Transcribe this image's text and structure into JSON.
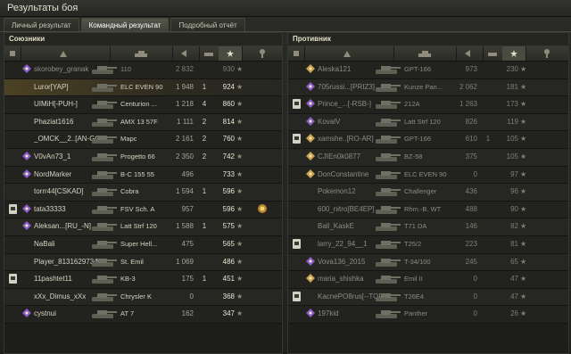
{
  "window": {
    "title": "Результаты боя"
  },
  "tabs": [
    {
      "label": "Личный результат",
      "active": false
    },
    {
      "label": "Командный результат",
      "active": true
    },
    {
      "label": "Подробный отчёт",
      "active": false
    }
  ],
  "allies": {
    "title": "Союзники",
    "rows": [
      {
        "name": "skorobey_granak",
        "tank": "110",
        "damage": "2 832",
        "frags": "",
        "xp": "930",
        "alive": false,
        "ribbon": false,
        "badge": "purple",
        "me": false
      },
      {
        "name": "Luror[YAP]",
        "tank": "ELC EVEN 90",
        "damage": "1 948",
        "frags": "1",
        "xp": "924",
        "alive": true,
        "ribbon": false,
        "badge": "",
        "me": true
      },
      {
        "name": "UIMiH[-PUH-]",
        "tank": "Centurion ...",
        "damage": "1 218",
        "frags": "4",
        "xp": "860",
        "alive": true,
        "ribbon": false,
        "badge": "",
        "me": false
      },
      {
        "name": "Phaziat1616",
        "tank": "AMX 13 57F",
        "damage": "1 111",
        "frags": "2",
        "xp": "814",
        "alive": true,
        "ribbon": false,
        "badge": "",
        "me": false
      },
      {
        "name": "_OMCK__2..[AN-GO]",
        "tank": "Марс",
        "damage": "2 161",
        "frags": "2",
        "xp": "760",
        "alive": true,
        "ribbon": false,
        "badge": "",
        "me": false
      },
      {
        "name": "V0vAn73_1",
        "tank": "Progetto 66",
        "damage": "2 350",
        "frags": "2",
        "xp": "742",
        "alive": true,
        "ribbon": false,
        "badge": "purple",
        "me": false
      },
      {
        "name": "NordMarker",
        "tank": "В-С 155 55",
        "damage": "496",
        "frags": "",
        "xp": "733",
        "alive": true,
        "ribbon": false,
        "badge": "purple",
        "me": false
      },
      {
        "name": "torrr44[CSKAD]",
        "tank": "Cobra",
        "damage": "1 594",
        "frags": "1",
        "xp": "596",
        "alive": true,
        "ribbon": false,
        "badge": "",
        "me": false
      },
      {
        "name": "tata33333",
        "tank": "FSV Sch. A",
        "damage": "957",
        "frags": "",
        "xp": "596",
        "alive": true,
        "ribbon": true,
        "badge": "purple",
        "me": false
      },
      {
        "name": "Aleksan...[RU_-N]",
        "tank": "Latt Strf 120",
        "damage": "1 588",
        "frags": "1",
        "xp": "575",
        "alive": true,
        "ribbon": false,
        "badge": "purple",
        "me": false
      },
      {
        "name": "NaBali",
        "tank": "Super Hell...",
        "damage": "475",
        "frags": "",
        "xp": "565",
        "alive": true,
        "ribbon": false,
        "badge": "",
        "me": false
      },
      {
        "name": "Player_8131629734",
        "tank": "St. Emil",
        "damage": "1 069",
        "frags": "",
        "xp": "486",
        "alive": true,
        "ribbon": false,
        "badge": "",
        "me": false
      },
      {
        "name": "11pashtet11",
        "tank": "KB-3",
        "damage": "175",
        "frags": "1",
        "xp": "451",
        "alive": true,
        "ribbon": true,
        "badge": "",
        "me": false
      },
      {
        "name": "xXx_Dimus_xXx",
        "tank": "Chrysler K",
        "damage": "0",
        "frags": "",
        "xp": "368",
        "alive": true,
        "ribbon": false,
        "badge": "",
        "me": false
      },
      {
        "name": "cystnui",
        "tank": "AT 7",
        "damage": "162",
        "frags": "",
        "xp": "347",
        "alive": true,
        "ribbon": false,
        "badge": "purple",
        "me": false
      }
    ]
  },
  "enemies": {
    "title": "Противник",
    "rows": [
      {
        "name": "Aleska121",
        "tank": "GPT-166",
        "damage": "973",
        "frags": "",
        "xp": "230",
        "alive": false,
        "ribbon": false,
        "badge": "gold"
      },
      {
        "name": "705russi...[PRIZ3]",
        "tank": "Kunze Pan...",
        "damage": "2 062",
        "frags": "",
        "xp": "181",
        "alive": false,
        "ribbon": false,
        "badge": "purple"
      },
      {
        "name": "Prince_...[-RSB-]",
        "tank": "212A",
        "damage": "1 263",
        "frags": "",
        "xp": "173",
        "alive": false,
        "ribbon": true,
        "badge": "purple"
      },
      {
        "name": "KovalV",
        "tank": "Latt Strf 120",
        "damage": "826",
        "frags": "",
        "xp": "119",
        "alive": false,
        "ribbon": false,
        "badge": "purple"
      },
      {
        "name": "xamshe..[RO-AR]",
        "tank": "GPT-166",
        "damage": "610",
        "frags": "1",
        "xp": "105",
        "alive": false,
        "ribbon": true,
        "badge": "gold"
      },
      {
        "name": "CJIEn0k0877",
        "tank": "BZ-58",
        "damage": "375",
        "frags": "",
        "xp": "105",
        "alive": false,
        "ribbon": false,
        "badge": "gold"
      },
      {
        "name": "DonConstantine",
        "tank": "ELC EVEN 90",
        "damage": "0",
        "frags": "",
        "xp": "97",
        "alive": false,
        "ribbon": false,
        "badge": "gold"
      },
      {
        "name": "Pokemon12",
        "tank": "Challenger",
        "damage": "436",
        "frags": "",
        "xp": "96",
        "alive": false,
        "ribbon": false,
        "badge": ""
      },
      {
        "name": "600_nitro[BE4EP]",
        "tank": "Rhm.-B. WT",
        "damage": "488",
        "frags": "",
        "xp": "90",
        "alive": false,
        "ribbon": false,
        "badge": ""
      },
      {
        "name": "Ball_KaskE",
        "tank": "T71 DA",
        "damage": "146",
        "frags": "",
        "xp": "82",
        "alive": false,
        "ribbon": false,
        "badge": ""
      },
      {
        "name": "larry_22_94__1",
        "tank": "T25/2",
        "damage": "223",
        "frags": "",
        "xp": "81",
        "alive": false,
        "ribbon": true,
        "badge": ""
      },
      {
        "name": "Vova136_2015",
        "tank": "T-34/100",
        "damage": "245",
        "frags": "",
        "xp": "65",
        "alive": false,
        "ribbon": false,
        "badge": "purple"
      },
      {
        "name": "maria_shishka",
        "tank": "Emil II",
        "damage": "0",
        "frags": "",
        "xp": "47",
        "alive": false,
        "ribbon": false,
        "badge": "gold"
      },
      {
        "name": "KacnePO8rus[--TOP]",
        "tank": "T26E4",
        "damage": "0",
        "frags": "",
        "xp": "47",
        "alive": false,
        "ribbon": true,
        "badge": ""
      },
      {
        "name": "197kid",
        "tank": "Panther",
        "damage": "0",
        "frags": "",
        "xp": "26",
        "alive": false,
        "ribbon": false,
        "badge": "purple"
      }
    ]
  },
  "colors": {
    "accent": "#d8b24a",
    "purple": "#8a5cc8",
    "gold": "#c9a24a",
    "deadText": "#807e72"
  }
}
